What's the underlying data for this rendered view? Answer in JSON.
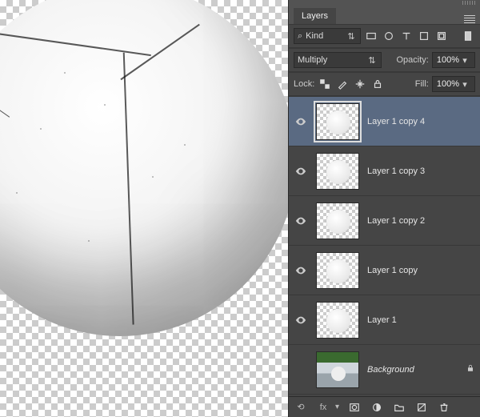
{
  "panel": {
    "title": "Layers",
    "filter": {
      "mode": "Kind"
    },
    "blend_mode": "Multiply",
    "opacity": {
      "label": "Opacity:",
      "value": "100%"
    },
    "lock": {
      "label": "Lock:"
    },
    "fill": {
      "label": "Fill:",
      "value": "100%"
    }
  },
  "layers": [
    {
      "name": "Layer 1 copy 4",
      "visible": true,
      "selected": true,
      "thumb_type": "sphere"
    },
    {
      "name": "Layer 1 copy 3",
      "visible": true,
      "selected": false,
      "thumb_type": "sphere"
    },
    {
      "name": "Layer 1 copy 2",
      "visible": true,
      "selected": false,
      "thumb_type": "sphere"
    },
    {
      "name": "Layer 1 copy",
      "visible": true,
      "selected": false,
      "thumb_type": "sphere"
    },
    {
      "name": "Layer 1",
      "visible": true,
      "selected": false,
      "thumb_type": "sphere"
    },
    {
      "name": "Background",
      "visible": false,
      "selected": false,
      "thumb_type": "photo",
      "bg": true,
      "locked": true
    }
  ],
  "icons": {
    "search": "⌕",
    "menu": "≡",
    "link": "⟲",
    "lock": "🔒",
    "trash": "🗑",
    "fx": "fx"
  }
}
